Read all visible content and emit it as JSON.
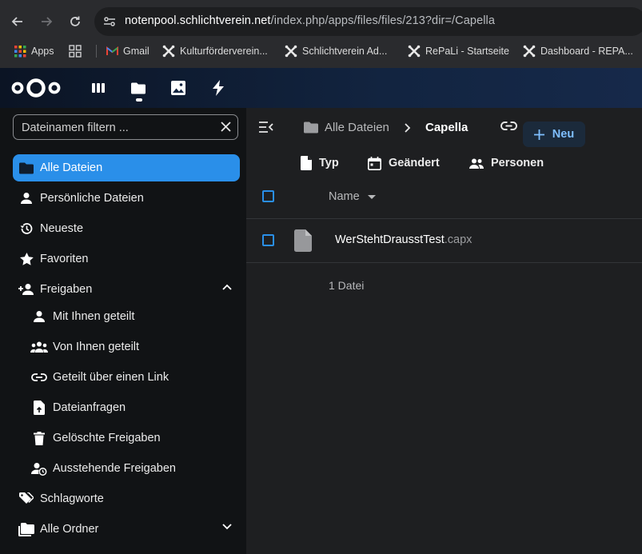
{
  "browser": {
    "url_host": "notenpool.schlichtverein.net",
    "url_path": "/index.php/apps/files/files/213?dir=/Capella",
    "bookmarks": [
      {
        "label": "Apps",
        "icon": "apps-grid-icon"
      },
      {
        "label": "",
        "icon": "tab-groups-icon"
      },
      {
        "label": "Gmail",
        "icon": "gmail-icon"
      },
      {
        "label": "Kulturförderverein...",
        "icon": "joomla-icon"
      },
      {
        "label": "Schlichtverein Ad...",
        "icon": "joomla-icon"
      },
      {
        "label": "RePaLi - Startseite",
        "icon": "joomla-icon"
      },
      {
        "label": "Dashboard - REPA...",
        "icon": "joomla-icon"
      }
    ]
  },
  "header": {
    "apps": [
      {
        "name": "dashboard",
        "icon": "dashboard-icon"
      },
      {
        "name": "files",
        "icon": "files-icon",
        "active": true
      },
      {
        "name": "photos",
        "icon": "photos-icon"
      },
      {
        "name": "activity",
        "icon": "activity-icon"
      }
    ]
  },
  "sidebar": {
    "filter_placeholder": "Dateinamen filtern ...",
    "items": [
      {
        "label": "Alle Dateien",
        "icon": "folder-icon",
        "active": true
      },
      {
        "label": "Persönliche Dateien",
        "icon": "user-icon"
      },
      {
        "label": "Neueste",
        "icon": "history-icon"
      },
      {
        "label": "Favoriten",
        "icon": "star-icon"
      },
      {
        "label": "Freigaben",
        "icon": "share-add-icon",
        "expanded": true
      },
      {
        "label": "Mit Ihnen geteilt",
        "icon": "user-icon"
      },
      {
        "label": "Von Ihnen geteilt",
        "icon": "group-icon"
      },
      {
        "label": "Geteilt über einen Link",
        "icon": "link-icon"
      },
      {
        "label": "Dateianfragen",
        "icon": "file-upload-icon"
      },
      {
        "label": "Gelöschte Freigaben",
        "icon": "trash-icon"
      },
      {
        "label": "Ausstehende Freigaben",
        "icon": "pending-share-icon"
      },
      {
        "label": "Schlagworte",
        "icon": "tags-icon"
      },
      {
        "label": "Alle Ordner",
        "icon": "folder-multiple-icon",
        "expanded": false
      }
    ]
  },
  "main": {
    "breadcrumb": {
      "root": "Alle Dateien",
      "current": "Capella"
    },
    "new_label": "Neu",
    "filters": {
      "type": "Typ",
      "modified": "Geändert",
      "people": "Personen"
    },
    "table": {
      "column_name": "Name",
      "rows": [
        {
          "basename": "WerStehtDrausstTest",
          "extension": ".capx",
          "icon": "file-icon"
        }
      ]
    },
    "summary": "1 Datei"
  },
  "colors": {
    "accent": "#2a8fe9",
    "sidebar_bg": "#111315",
    "main_bg": "#1e1f21",
    "header_bg": "#122440"
  }
}
